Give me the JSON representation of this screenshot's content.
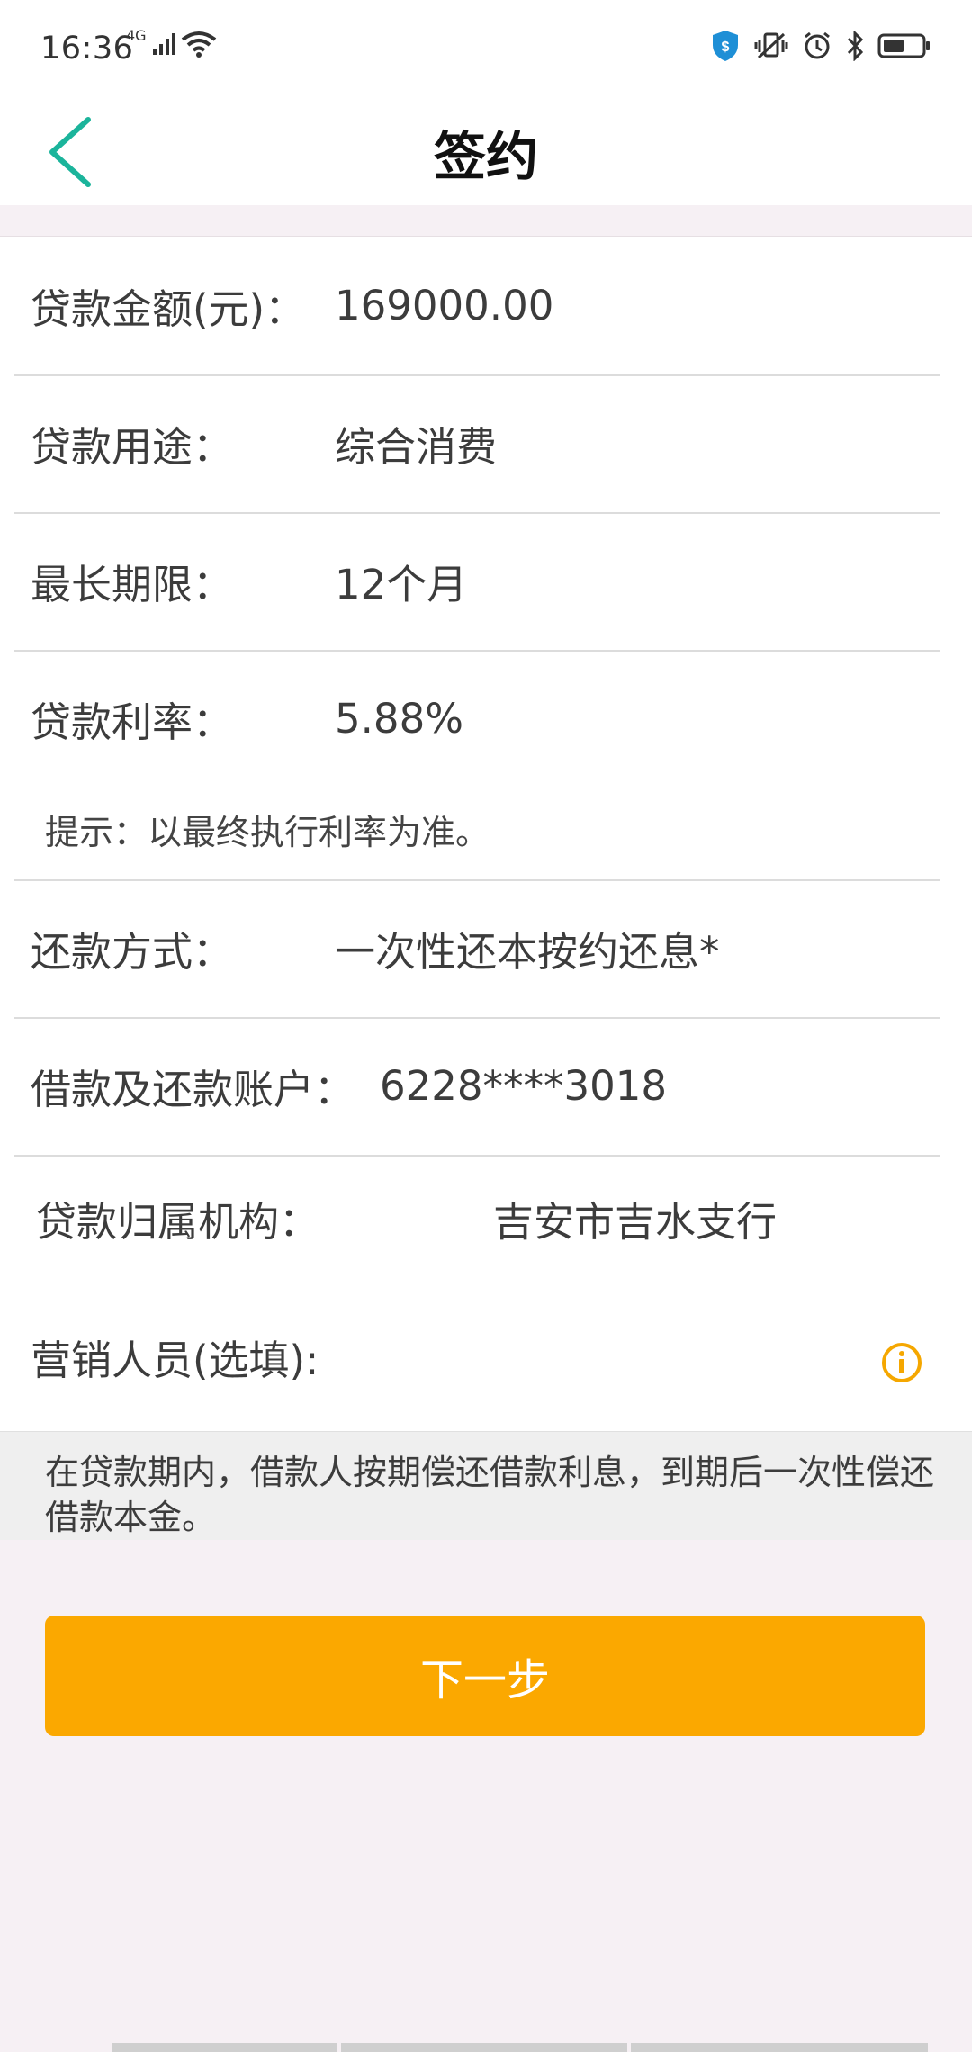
{
  "status_bar": {
    "time": "16:36",
    "network": "4G"
  },
  "nav": {
    "title": "签约"
  },
  "form": {
    "rows": [
      {
        "label": "贷款金额(元)：",
        "value": "169000.00"
      },
      {
        "label": "贷款用途：",
        "value": "综合消费"
      },
      {
        "label": "最长期限：",
        "value": "12个月"
      },
      {
        "label": "贷款利率：",
        "value": "5.88%"
      },
      {
        "label": "还款方式：",
        "value": "一次性还本按约还息*"
      },
      {
        "label": "借款及还款账户：",
        "value": "6228****3018"
      },
      {
        "label": "贷款归属机构：",
        "value": "吉安市吉水支行"
      },
      {
        "label": "营销人员(选填):",
        "value": ""
      }
    ],
    "rate_hint": "提示：以最终执行利率为准。"
  },
  "note": "在贷款期内，借款人按期偿还借款利息，到期后一次性偿还借款本金。",
  "next_button": "下一步",
  "colors": {
    "accent": "#1bb49b",
    "button": "#fba800",
    "info": "#f5a700"
  }
}
